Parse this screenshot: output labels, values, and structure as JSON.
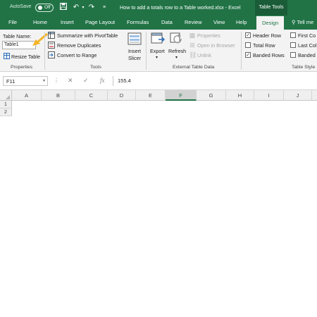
{
  "titlebar": {
    "autosave_label": "AutoSave",
    "autosave_state": "Off",
    "document_title": "How to add a totals row to a Table worked.xlsx - Excel",
    "contextual_tab": "Table Tools"
  },
  "tabs": [
    "File",
    "Home",
    "Insert",
    "Page Layout",
    "Formulas",
    "Data",
    "Review",
    "View",
    "Help",
    "Design"
  ],
  "active_tab": "Design",
  "tell_me": "Tell me",
  "ribbon": {
    "properties": {
      "table_name_label": "Table Name:",
      "table_name_value": "Table1",
      "resize_label": "Resize Table",
      "group_label": "Properties"
    },
    "tools": {
      "summarize_label": "Summarize with PivotTable",
      "remove_duplicates_label": "Remove Duplicates",
      "convert_label": "Convert to Range",
      "insert_slicer_line1": "Insert",
      "insert_slicer_line2": "Slicer",
      "group_label": "Tools"
    },
    "external": {
      "export_label": "Export",
      "refresh_label": "Refresh",
      "properties_label": "Properties",
      "open_browser_label": "Open in Browser",
      "unlink_label": "Unlink",
      "group_label": "External Table Data"
    },
    "style_options": {
      "header_row_label": "Header Row",
      "header_row_checked": true,
      "total_row_label": "Total Row",
      "total_row_checked": false,
      "banded_rows_label": "Banded Rows",
      "banded_rows_checked": true,
      "first_column_label": "First Co",
      "last_column_label": "Last Col",
      "banded_columns_label": "Banded",
      "group_label": "Table Style"
    }
  },
  "formula_bar": {
    "name_box": "F11",
    "fx_symbol": "fx",
    "value": "155.4"
  },
  "grid": {
    "columns": [
      "A",
      "B",
      "C",
      "D",
      "E",
      "F",
      "G",
      "H",
      "I",
      "J"
    ],
    "selected_column": "F",
    "rows": [
      "1",
      "2"
    ]
  },
  "colors": {
    "excel_green": "#217346",
    "annotation_arrow": "#f5b324"
  }
}
